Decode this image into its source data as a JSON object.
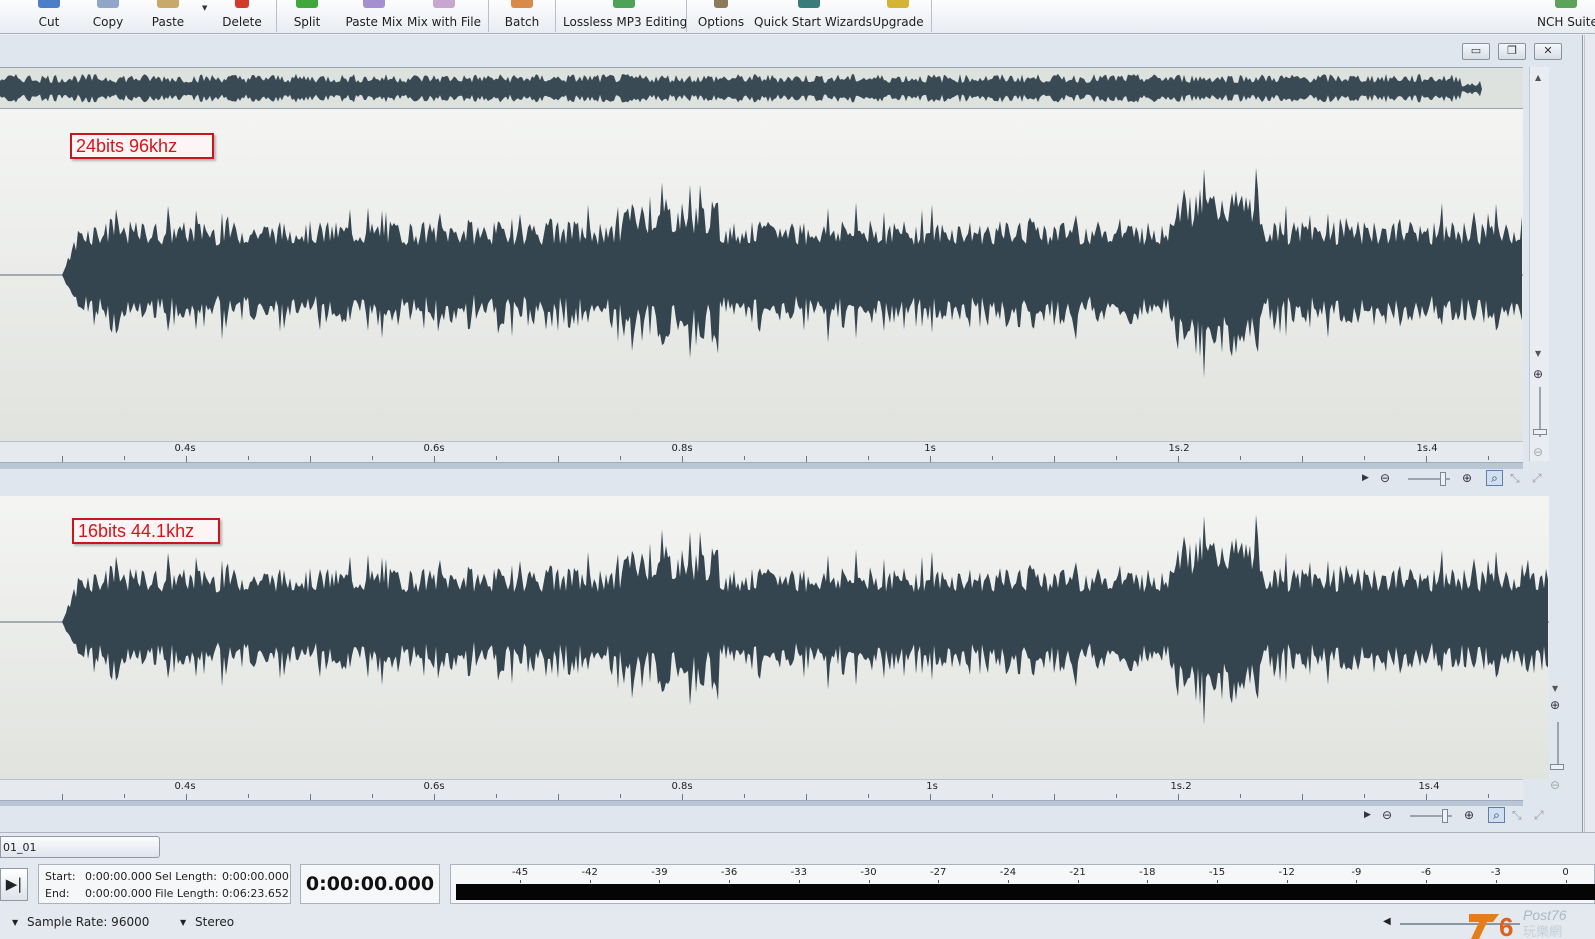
{
  "toolbar": {
    "buttons": [
      {
        "label": "Cut",
        "icon": "scissors-icon"
      },
      {
        "label": "Copy",
        "icon": "copy-icon"
      },
      {
        "label": "Paste",
        "icon": "paste-icon"
      },
      {
        "label": "Delete",
        "icon": "delete-icon"
      },
      {
        "label": "Split",
        "icon": "split-icon"
      },
      {
        "label": "Paste Mix",
        "icon": "paste-mix-icon"
      },
      {
        "label": "Mix with File",
        "icon": "mix-file-icon"
      },
      {
        "label": "Batch",
        "icon": "batch-icon"
      },
      {
        "label": "Lossless MP3 Editing",
        "icon": "mp3-icon"
      },
      {
        "label": "Options",
        "icon": "options-icon"
      },
      {
        "label": "Quick Start Wizards",
        "icon": "wizard-icon"
      },
      {
        "label": "Upgrade",
        "icon": "upgrade-icon"
      },
      {
        "label": "NCH Suite",
        "icon": "nch-suite-icon"
      }
    ]
  },
  "window_controls": {
    "minimize": "▭",
    "restore": "❐",
    "close": "✕"
  },
  "channels": [
    {
      "annotation": "24bits 96khz",
      "ticks": [
        "0.4s",
        "0.6s",
        "0.8s",
        "1s",
        "1s.2",
        "1s.4"
      ]
    },
    {
      "annotation": "16bits 44.1khz",
      "ticks": [
        "0.4s",
        "0.6s",
        "0.8s",
        "1s",
        "1s.2",
        "1s.4"
      ]
    }
  ],
  "file_tab": {
    "name": "01_01"
  },
  "status": {
    "start_label": "Start:",
    "start_value": "0:00:00.000",
    "end_label": "End:",
    "end_value": "0:00:00.000",
    "sel_length_label": "Sel Length:",
    "sel_length_value": "0:00:00.000",
    "file_length_label": "File Length:",
    "file_length_value": "0:06:23.652",
    "clock": "0:00:00.000"
  },
  "meter": {
    "labels": [
      "-45",
      "-42",
      "-39",
      "-36",
      "-33",
      "-30",
      "-27",
      "-24",
      "-21",
      "-18",
      "-15",
      "-12",
      "-9",
      "-6",
      "-3",
      "0"
    ]
  },
  "bottom": {
    "sample_rate": "Sample Rate: 96000",
    "channels": "Stereo"
  },
  "colors": {
    "waveform": "#3a4a55",
    "annotation": "#d8141b",
    "background": "#e9edf2"
  }
}
